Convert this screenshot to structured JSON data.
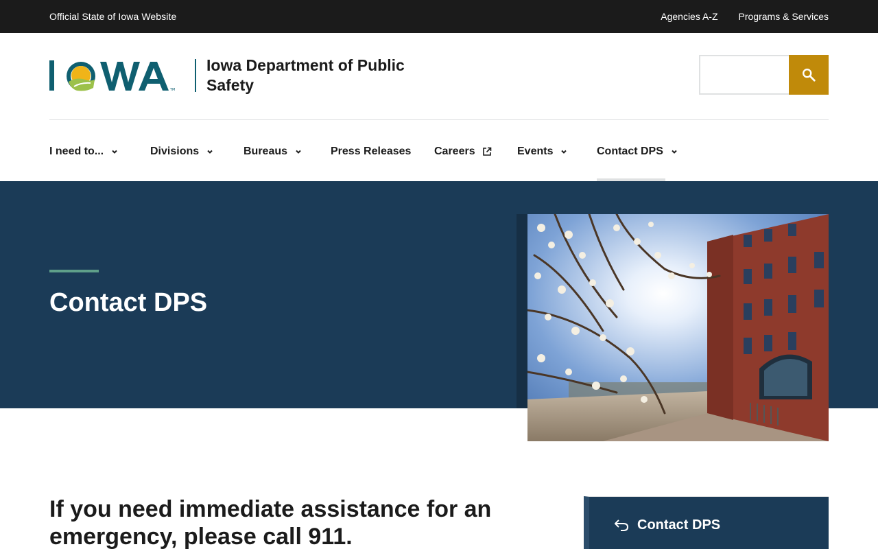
{
  "utility": {
    "official_label": "Official State of Iowa Website",
    "links": [
      "Agencies A-Z",
      "Programs & Services"
    ]
  },
  "header": {
    "logo_text": "IOWA",
    "site_name": "Iowa Department of Public Safety",
    "search": {
      "placeholder": "",
      "value": "",
      "button_icon": "search-icon"
    }
  },
  "nav": {
    "items": [
      {
        "label": "I need to...",
        "icon": "chevron-down-icon"
      },
      {
        "label": "Divisions",
        "icon": "chevron-down-icon"
      },
      {
        "label": "Bureaus",
        "icon": "chevron-down-icon"
      },
      {
        "label": "Press Releases"
      },
      {
        "label": "Careers",
        "icon": "external-link-icon"
      },
      {
        "label": "Events",
        "icon": "chevron-down-icon"
      },
      {
        "label": "Contact DPS",
        "icon": "chevron-down-icon",
        "active": true
      }
    ]
  },
  "hero": {
    "title": "Contact DPS"
  },
  "content": {
    "emergency_heading": "If you need immediate assistance for an emergency, please call 911."
  },
  "side_nav": {
    "back_icon": "return-arrow-icon",
    "label": "Contact DPS"
  },
  "colors": {
    "utility_bar": "#1b1b1b",
    "hero_bg": "#1b3b57",
    "search_button": "#c08a0a",
    "accent": "#5fa08a",
    "logo_teal": "#0f5f70"
  }
}
